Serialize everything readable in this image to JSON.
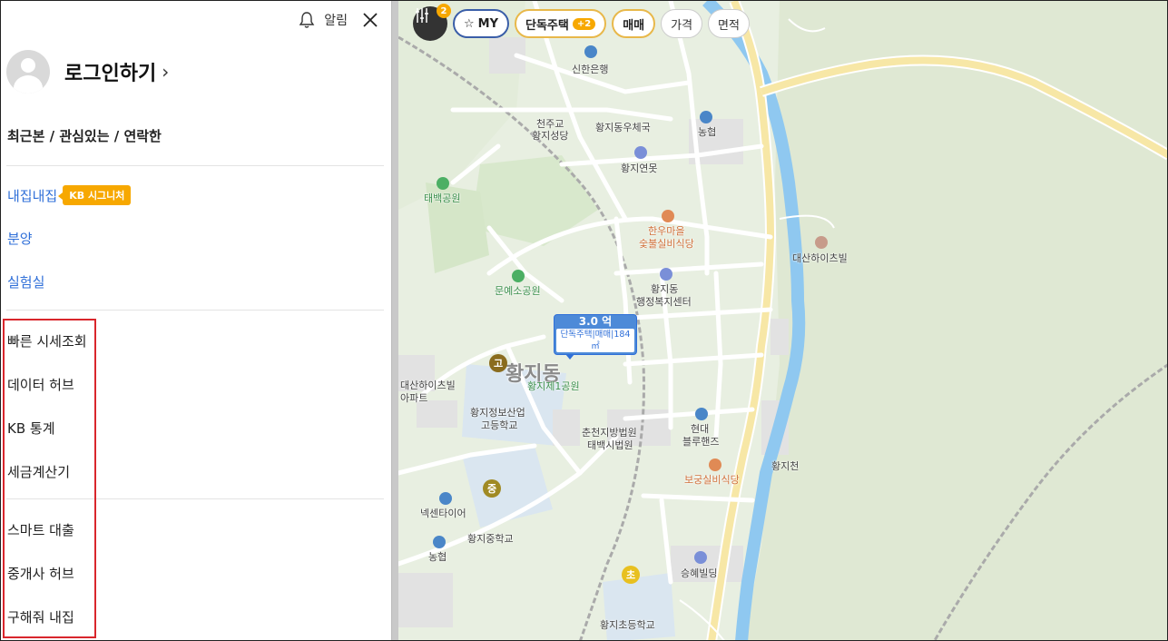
{
  "sidebar": {
    "alarm_label": "알림",
    "login_label": "로그인하기",
    "login_chevron": "›",
    "recent_label": "최근본 / 관심있는 / 연락한",
    "blue_items": [
      {
        "label": "내집내집",
        "badge": "KB 시그니처"
      },
      {
        "label": "분양"
      },
      {
        "label": "실험실"
      }
    ],
    "menu_group1": [
      "빠른 시세조회",
      "데이터 허브",
      "KB 통계",
      "세금계산기"
    ],
    "menu_group2": [
      "스마트 대출",
      "중개사 허브",
      "구해줘 내집"
    ]
  },
  "filters": {
    "count": "2",
    "my": "MY",
    "house_type": "단독주택",
    "house_type_plus": "+2",
    "deal": "매매",
    "price": "가격",
    "area": "면적"
  },
  "price_tag": {
    "value": "3.0 억",
    "desc": "단독주택|매매|184㎡"
  },
  "map_labels": {
    "shinhan": "신한은행",
    "cathedral_1": "천주교",
    "cathedral_2": "황지성당",
    "post": "황지동우체국",
    "nonghyup1": "농협",
    "pond": "황지연못",
    "taebaek_park": "태백공원",
    "hanu_1": "한우마을",
    "hanu_2": "숯불실비식당",
    "daesan": "대산하이츠빌",
    "center_1": "황지동",
    "center_2": "행정복지센터",
    "munye": "문예소공원",
    "district": "황지동",
    "park1": "황지제1공원",
    "daesan_apt_1": "대산하이츠빌",
    "daesan_apt_2": "아파트",
    "hs_1": "황지정보산업",
    "hs_2": "고등학교",
    "court_1": "춘천지방법원",
    "court_2": "태백시법원",
    "hyundai_1": "현대",
    "hyundai_2": "블루핸즈",
    "stream": "황지천",
    "bogung": "보궁실비식당",
    "nexen": "넥센타이어",
    "ms": "황지중학교",
    "nonghyup2": "농협",
    "seunghye": "승혜빌딩",
    "es": "황지초등학교",
    "school_go": "고",
    "school_jung": "중",
    "school_cho": "초"
  },
  "colors": {
    "accent_blue": "#2f6fd8",
    "badge_orange": "#f7a800",
    "highlight_red": "#d9262c"
  }
}
